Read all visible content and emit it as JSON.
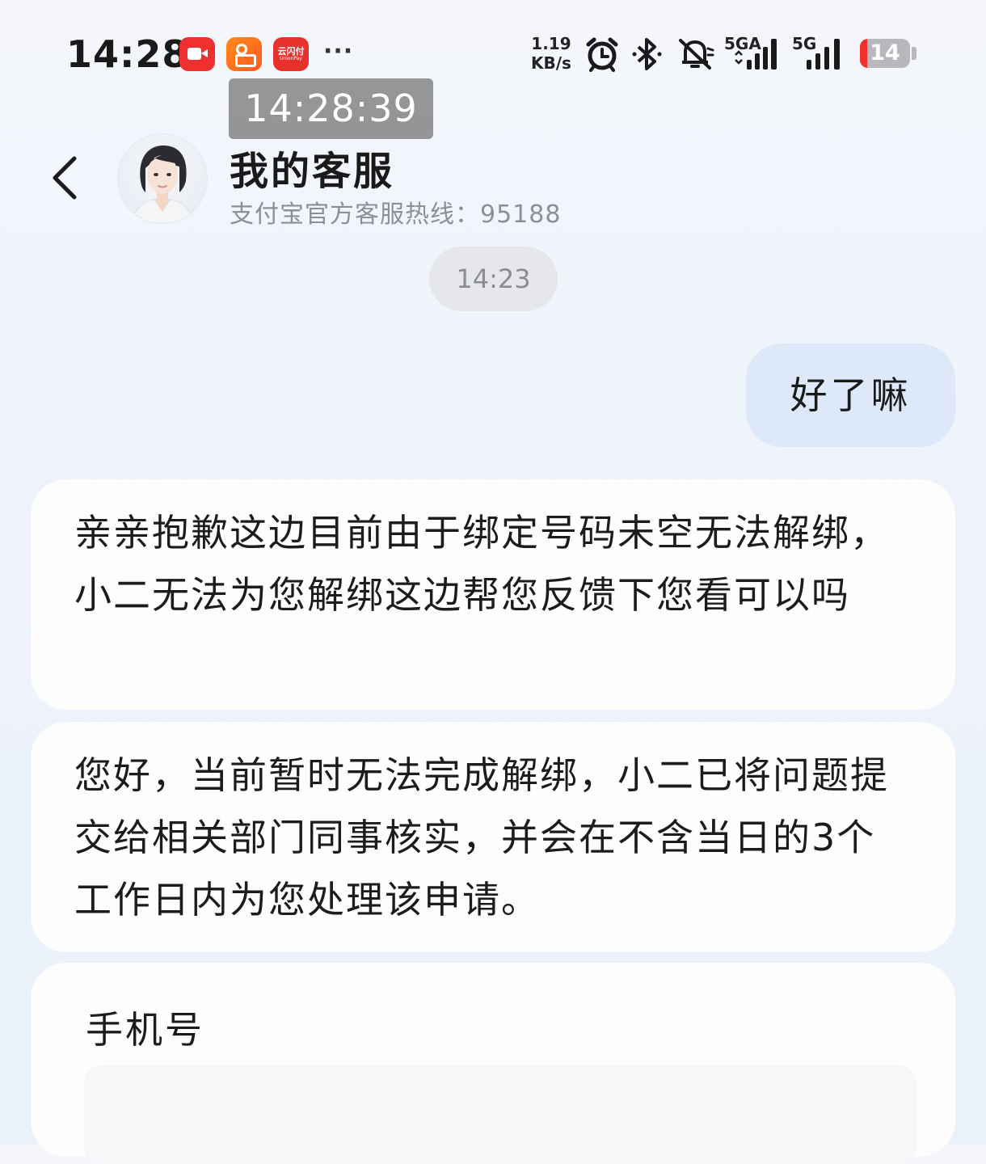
{
  "status_bar": {
    "time": "14:28",
    "speed_value": "1.19",
    "speed_unit": "KB/s",
    "network1": "5GA",
    "network2": "5G",
    "battery": "14",
    "battery_level": 0.14,
    "more": "···",
    "app_icons": [
      "video-app-icon",
      "kuaishou-app-icon",
      "yunshanfu-app-icon"
    ],
    "yunshanfu_text": "云闪付",
    "yunshanfu_sub": "UnionPay",
    "colors": {
      "battery_low": "#f0302f",
      "app_red": "#f0302f"
    }
  },
  "overlay_timestamp": "14:28:39",
  "header": {
    "back_icon": "chevron-left-icon",
    "title": "我的客服",
    "subtitle": "支付宝官方客服热线：95188"
  },
  "chat": {
    "time_chip": "14:23",
    "messages": [
      {
        "sender": "user",
        "text": "好了嘛"
      },
      {
        "sender": "agent",
        "text": "亲亲抱歉这边目前由于绑定号码未空无法解绑，小二无法为您解绑这边帮您反馈下您看可以吗"
      },
      {
        "sender": "agent",
        "text": "您好，当前暂时无法完成解绑，小二已将问题提交给相关部门同事核实，并会在不含当日的3个工作日内为您处理该申请。"
      }
    ],
    "form_card": {
      "label": "手机号",
      "value": ""
    }
  },
  "colors": {
    "user_bubble": "#dde8f8",
    "agent_bubble": "#fdfdfe",
    "subtitle_text": "#8c8f96"
  }
}
